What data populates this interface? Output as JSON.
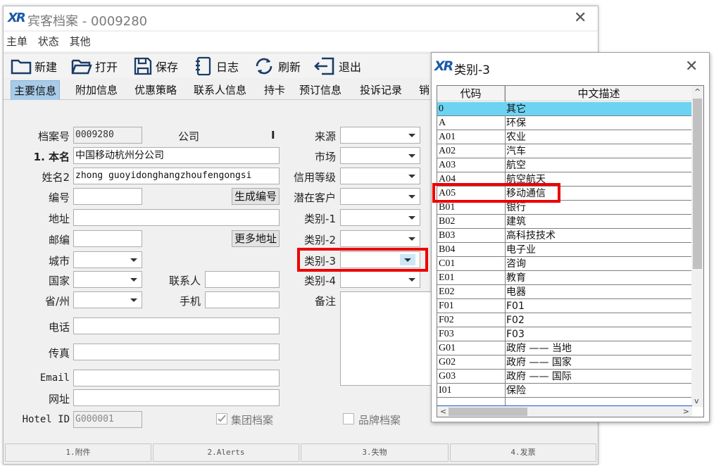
{
  "main_window": {
    "title": "宾客档案 - 0009280",
    "menu": [
      "主单",
      "状态",
      "其他"
    ],
    "toolbar": [
      {
        "label": "新建",
        "icon": "folder-icon"
      },
      {
        "label": "打开",
        "icon": "folder-open-icon"
      },
      {
        "label": "保存",
        "icon": "save-icon"
      },
      {
        "label": "日志",
        "icon": "notebook-icon"
      },
      {
        "label": "刷新",
        "icon": "refresh-icon"
      },
      {
        "label": "退出",
        "icon": "exit-icon"
      }
    ],
    "tabs": [
      "主要信息",
      "附加信息",
      "优惠策略",
      "联系人信息",
      "持卡",
      "预订信息",
      "投诉记录",
      "销"
    ],
    "active_tab": "主要信息"
  },
  "form": {
    "archive_no": {
      "label": "档案号",
      "value": "0009280"
    },
    "company": {
      "label": "公司",
      "value": "I"
    },
    "name": {
      "label": "1. 本名",
      "value": "中国移动杭州分公司"
    },
    "name2": {
      "label": "姓名2",
      "value": "zhong guoyidonghangzhoufengongsi"
    },
    "code": {
      "label": "编号",
      "value": ""
    },
    "generate_code_button": "生成编号",
    "address": {
      "label": "地址",
      "value": ""
    },
    "postcode": {
      "label": "邮编",
      "value": ""
    },
    "more_address_button": "更多地址",
    "city": {
      "label": "城市",
      "value": ""
    },
    "country": {
      "label": "国家",
      "value": ""
    },
    "contact": {
      "label": "联系人",
      "value": ""
    },
    "province": {
      "label": "省/州",
      "value": ""
    },
    "mobile": {
      "label": "手机",
      "value": ""
    },
    "phone": {
      "label": "电话",
      "value": ""
    },
    "fax": {
      "label": "传真",
      "value": ""
    },
    "email": {
      "label": "Email",
      "value": ""
    },
    "website": {
      "label": "网址",
      "value": ""
    },
    "hotel_id": {
      "label": "Hotel ID",
      "value": "G000001"
    },
    "group_archive": {
      "label": "集团档案",
      "checked": true
    },
    "brand_archive": {
      "label": "品牌档案",
      "checked": false
    },
    "source": {
      "label": "来源",
      "value": ""
    },
    "market": {
      "label": "市场",
      "value": ""
    },
    "credit_level": {
      "label": "信用等级",
      "value": ""
    },
    "potential_customer": {
      "label": "潜在客户",
      "value": ""
    },
    "category1": {
      "label": "类别-1",
      "value": ""
    },
    "category2": {
      "label": "类别-2",
      "value": ""
    },
    "category3": {
      "label": "类别-3",
      "value": ""
    },
    "category4": {
      "label": "类别-4",
      "value": ""
    },
    "remark": {
      "label": "备注",
      "value": ""
    }
  },
  "status_bar": [
    "1.附件",
    "2.Alerts",
    "3.失物",
    "4.发票"
  ],
  "popup": {
    "title": "类别-3",
    "columns": [
      "代码",
      "中文描述"
    ],
    "selected_code": "0",
    "highlighted_code": "A05",
    "rows": [
      {
        "code": "0",
        "desc": "其它"
      },
      {
        "code": "A",
        "desc": "环保"
      },
      {
        "code": "A01",
        "desc": "农业"
      },
      {
        "code": "A02",
        "desc": "汽车"
      },
      {
        "code": "A03",
        "desc": "航空"
      },
      {
        "code": "A04",
        "desc": "航空航天"
      },
      {
        "code": "A05",
        "desc": "移动通信"
      },
      {
        "code": "B01",
        "desc": "银行"
      },
      {
        "code": "B02",
        "desc": "建筑"
      },
      {
        "code": "B03",
        "desc": "高科技技术"
      },
      {
        "code": "B04",
        "desc": "电子业"
      },
      {
        "code": "C01",
        "desc": "咨询"
      },
      {
        "code": "E01",
        "desc": "教育"
      },
      {
        "code": "E02",
        "desc": "电器"
      },
      {
        "code": "F01",
        "desc": "F01"
      },
      {
        "code": "F02",
        "desc": "F02"
      },
      {
        "code": "F03",
        "desc": "F03"
      },
      {
        "code": "G01",
        "desc": "政府 —— 当地"
      },
      {
        "code": "G02",
        "desc": "政府 —— 国家"
      },
      {
        "code": "G03",
        "desc": "政府 —— 国际"
      },
      {
        "code": "I01",
        "desc": "保险"
      }
    ]
  },
  "colors": {
    "selected_row": "#6dd3f2",
    "active_tab": "#a8cbe8",
    "annotation_red": "#ee0000",
    "logo_blue": "#1b5aa8"
  }
}
